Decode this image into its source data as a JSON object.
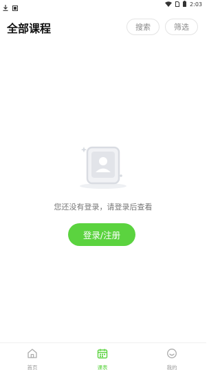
{
  "status_bar": {
    "time": "2:03",
    "icons": [
      "download-icon",
      "notification-icon",
      "wifi-icon",
      "sim-icon",
      "battery-icon"
    ]
  },
  "header": {
    "title": "全部课程",
    "search_label": "搜索",
    "filter_label": "筛选"
  },
  "empty_state": {
    "message": "您还没有登录，请登录后查看",
    "login_button_label": "登录/注册",
    "illustration_icon": "profile-card-icon"
  },
  "tabbar": {
    "items": [
      {
        "label": "首页",
        "icon": "home-icon",
        "active": false
      },
      {
        "label": "课表",
        "icon": "calendar-icon",
        "active": true
      },
      {
        "label": "我的",
        "icon": "smile-icon",
        "active": false
      }
    ]
  },
  "colors": {
    "accent": "#5bd33f",
    "inactive_tab": "#999999",
    "text_muted": "#777777"
  }
}
